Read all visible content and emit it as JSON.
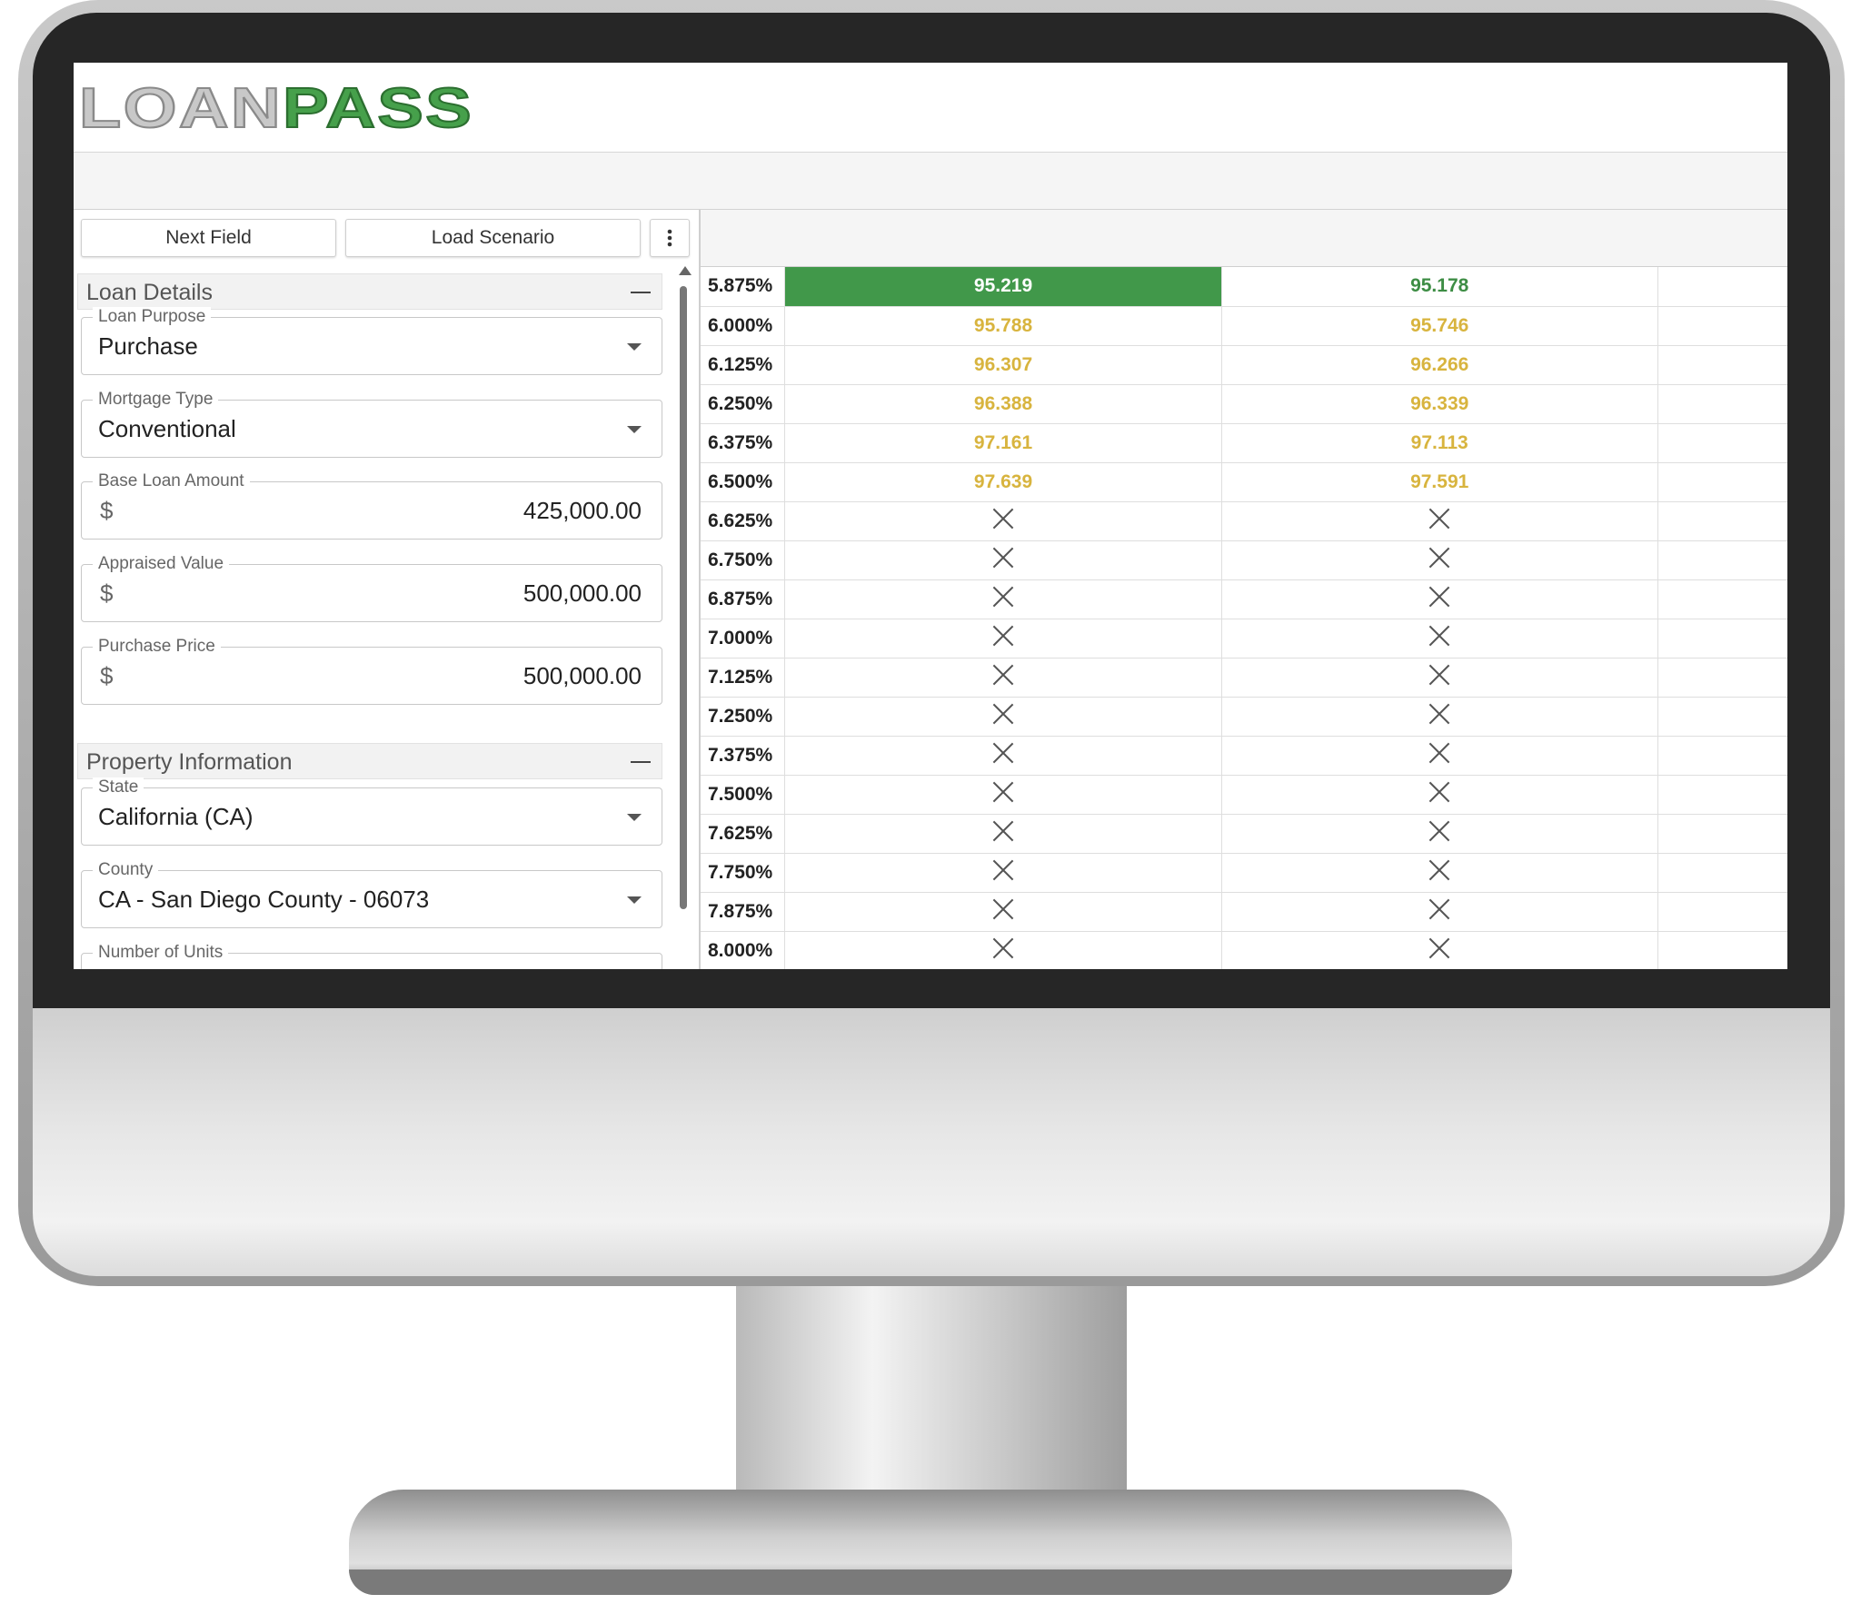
{
  "brand": {
    "logo_part1": "LOAN",
    "logo_part2": "PASS",
    "accent": "#41984a",
    "price_color": "#d8b43e"
  },
  "toolbar": {
    "next_field": "Next Field",
    "load_scenario": "Load Scenario",
    "more_icon": "vertical-dots-icon"
  },
  "sections": {
    "loan_details": {
      "title": "Loan Details",
      "loan_purpose": {
        "label": "Loan Purpose",
        "value": "Purchase"
      },
      "mortgage_type": {
        "label": "Mortgage Type",
        "value": "Conventional"
      },
      "base_loan_amount": {
        "label": "Base Loan Amount",
        "currency": "$",
        "value": "425,000.00"
      },
      "appraised_value": {
        "label": "Appraised Value",
        "currency": "$",
        "value": "500,000.00"
      },
      "purchase_price": {
        "label": "Purchase Price",
        "currency": "$",
        "value": "500,000.00"
      }
    },
    "property_information": {
      "title": "Property Information",
      "state": {
        "label": "State",
        "value": "California (CA)"
      },
      "county": {
        "label": "County",
        "value": "CA - San Diego County - 06073"
      },
      "number_of_units": {
        "label": "Number of Units"
      }
    }
  },
  "pricing": {
    "rows": [
      {
        "rate": "5.875%",
        "p1": "95.219",
        "p2": "95.178",
        "best": true
      },
      {
        "rate": "6.000%",
        "p1": "95.788",
        "p2": "95.746"
      },
      {
        "rate": "6.125%",
        "p1": "96.307",
        "p2": "96.266"
      },
      {
        "rate": "6.250%",
        "p1": "96.388",
        "p2": "96.339"
      },
      {
        "rate": "6.375%",
        "p1": "97.161",
        "p2": "97.113"
      },
      {
        "rate": "6.500%",
        "p1": "97.639",
        "p2": "97.591"
      },
      {
        "rate": "6.625%",
        "p1": null,
        "p2": null
      },
      {
        "rate": "6.750%",
        "p1": null,
        "p2": null
      },
      {
        "rate": "6.875%",
        "p1": null,
        "p2": null
      },
      {
        "rate": "7.000%",
        "p1": null,
        "p2": null
      },
      {
        "rate": "7.125%",
        "p1": null,
        "p2": null
      },
      {
        "rate": "7.250%",
        "p1": null,
        "p2": null
      },
      {
        "rate": "7.375%",
        "p1": null,
        "p2": null
      },
      {
        "rate": "7.500%",
        "p1": null,
        "p2": null
      },
      {
        "rate": "7.625%",
        "p1": null,
        "p2": null
      },
      {
        "rate": "7.750%",
        "p1": null,
        "p2": null
      },
      {
        "rate": "7.875%",
        "p1": null,
        "p2": null
      },
      {
        "rate": "8.000%",
        "p1": null,
        "p2": null
      }
    ]
  }
}
